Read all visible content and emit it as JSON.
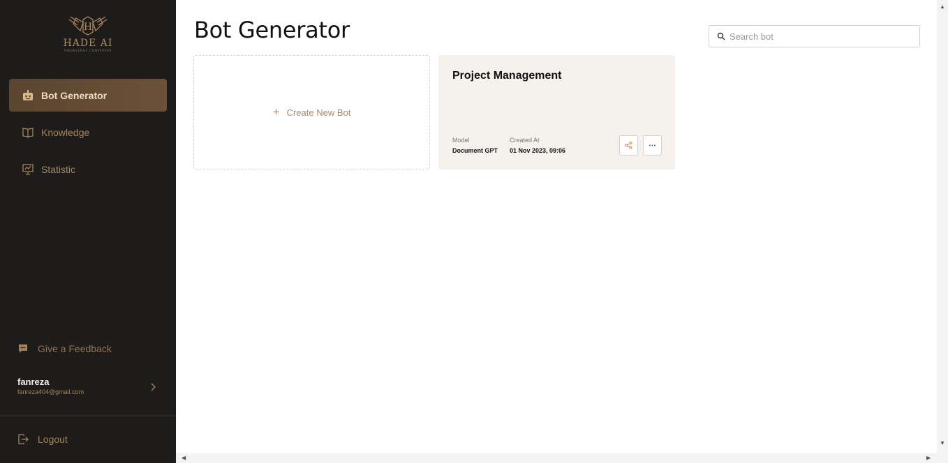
{
  "brand": {
    "name": "HADE AI",
    "tagline": "KNOWLEDGE CONVERTER",
    "logo_icon": "h-wings-logo",
    "accent": "#b38a5c"
  },
  "sidebar": {
    "background": "#1d1c1b",
    "items": [
      {
        "label": "Bot Generator",
        "icon": "robot-icon",
        "active": true
      },
      {
        "label": "Knowledge",
        "icon": "book-icon",
        "active": false
      },
      {
        "label": "Statistic",
        "icon": "presentation-chart-icon",
        "active": false
      }
    ],
    "feedback_label": "Give a Feedback",
    "user": {
      "name": "fanreza",
      "email": "fanreza404@gmail.com"
    },
    "logout_label": "Logout"
  },
  "main": {
    "title": "Bot Generator",
    "search": {
      "placeholder": "Search bot",
      "value": ""
    },
    "create_card": {
      "label": "Create New Bot"
    },
    "bots": [
      {
        "name": "Project Management",
        "model_label": "Model",
        "model_value": "Document GPT",
        "created_label": "Created At",
        "created_value": "01 Nov 2023, 09:06"
      }
    ]
  }
}
